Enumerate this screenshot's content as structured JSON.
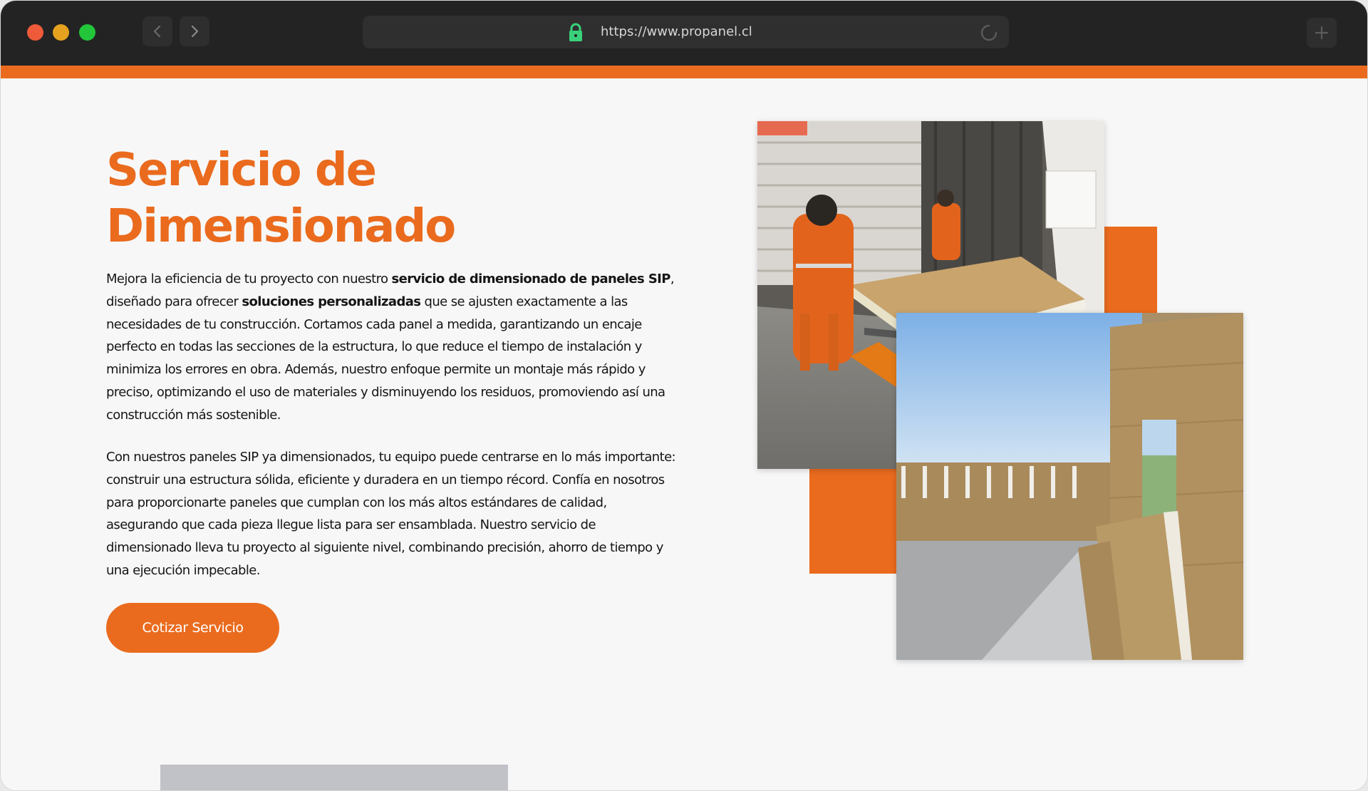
{
  "browser": {
    "url": "https://www.propanel.cl"
  },
  "page": {
    "title_line1": "Servicio de",
    "title_line2": "Dimensionado",
    "paragraph1": {
      "t1": "Mejora la eficiencia de tu proyecto con nuestro ",
      "b1": "servicio de dimensionado de paneles SIP",
      "t2": ", diseñado para ofrecer ",
      "b2": "soluciones personalizadas",
      "t3": " que se ajusten exactamente a las necesidades de tu construcción. Cortamos cada panel a medida, garantizando un encaje perfecto en todas las secciones de la estructura, lo que reduce el tiempo de instalación y minimiza los errores en obra. Además, nuestro enfoque permite un montaje más rápido y preciso, optimizando el uso de materiales y disminuyendo los residuos, promoviendo así una construcción más sostenible."
    },
    "paragraph2": "Con nuestros paneles SIP ya dimensionados, tu equipo puede centrarse en lo más importante: construir una estructura sólida, eficiente y duradera en un tiempo récord. Confía en nosotros para proporcionarte paneles que cumplan con los más altos estándares de calidad, asegurando que cada pieza llegue lista para ser ensamblada. Nuestro servicio de dimensionado lleva tu proyecto al siguiente nivel, combinando precisión, ahorro de tiempo y una ejecución impecable.",
    "cta_label": "Cotizar Servicio"
  },
  "images": {
    "photo1": "workers-cutting-sip-panel-photo",
    "photo2": "sip-panel-construction-site-photo"
  },
  "colors": {
    "accent": "#ea6b1e",
    "chrome": "#232323",
    "background": "#f7f7f7"
  }
}
